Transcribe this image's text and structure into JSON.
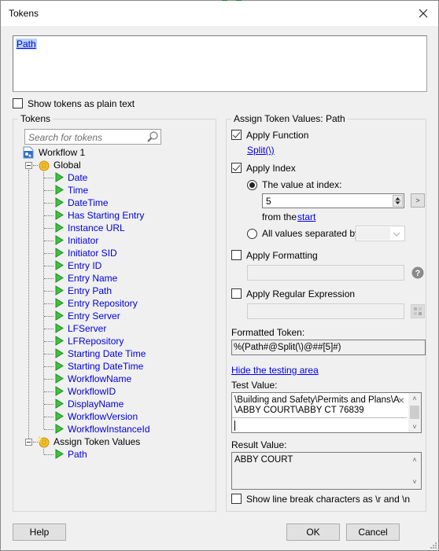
{
  "window": {
    "title": "Tokens",
    "close_icon": "close-icon"
  },
  "editor": {
    "token_text": "Path"
  },
  "show_plain_text": {
    "label": "Show tokens as plain text",
    "checked": false
  },
  "tokens_panel": {
    "title": "Tokens",
    "search_placeholder": "Search for tokens",
    "root": {
      "label": "Workflow 1",
      "icon": "workflow-document-icon"
    },
    "groups": [
      {
        "label": "Global",
        "icon": "global-token-icon",
        "expanded": true,
        "items": [
          "Date",
          "Time",
          "DateTime",
          "Has Starting Entry",
          "Instance URL",
          "Initiator",
          "Initiator SID",
          "Entry ID",
          "Entry Name",
          "Entry Path",
          "Entry Repository",
          "Entry Server",
          "LFServer",
          "LFRepository",
          "Starting Date Time",
          "Starting DateTime",
          "WorkflowName",
          "WorkflowID",
          "DisplayName",
          "WorkflowVersion",
          "WorkflowInstanceId"
        ]
      },
      {
        "label": "Assign Token Values",
        "icon": "assign-token-icon",
        "expanded": true,
        "items": [
          "Path"
        ]
      }
    ]
  },
  "assign_panel": {
    "title": "Assign Token Values: Path",
    "apply_function": {
      "label": "Apply Function",
      "checked": true,
      "link": "Split(\\)"
    },
    "apply_index": {
      "label": "Apply Index",
      "checked": true,
      "value_at_index": {
        "label": "The value at index:",
        "selected": true,
        "value": "5"
      },
      "from_the": "from the",
      "from_link": "start",
      "next_button": ">",
      "all_values": {
        "label": "All values separated by:",
        "selected": false,
        "value": ""
      }
    },
    "apply_formatting": {
      "label": "Apply Formatting",
      "checked": false,
      "value": "",
      "help_icon": "help-icon"
    },
    "apply_regex": {
      "label": "Apply Regular Expression",
      "checked": false,
      "value": "",
      "builder_icon": "regex-builder-icon"
    },
    "formatted_token": {
      "label": "Formatted Token:",
      "value": "%(Path#@Split(\\)@##[5]#)"
    },
    "hide_testing_link": "Hide the testing area",
    "test_value": {
      "label": "Test Value:",
      "line1": "\\Building and Safety\\Permits and Plans\\A",
      "line2": "\\ABBY COURT\\ABBY CT 76839",
      "clear_icon": "×"
    },
    "result_value": {
      "label": "Result Value:",
      "value": "ABBY COURT"
    },
    "show_line_breaks": {
      "label": "Show line break characters as \\r and \\n",
      "checked": false
    }
  },
  "footer": {
    "help": "Help",
    "ok": "OK",
    "cancel": "Cancel"
  }
}
